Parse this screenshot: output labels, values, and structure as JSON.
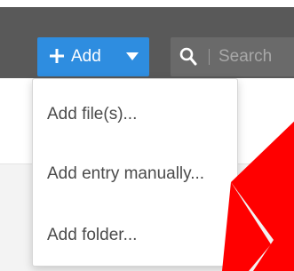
{
  "toolbar": {
    "add_label": "Add",
    "add_icon": "plus-icon",
    "caret_icon": "caret-down-icon",
    "search_icon": "search-icon",
    "search_placeholder": "Search"
  },
  "add_menu": {
    "items": [
      {
        "label": "Add file(s)..."
      },
      {
        "label": "Add entry manually..."
      },
      {
        "label": "Add folder..."
      }
    ]
  },
  "annotation": {
    "arrow_color": "#ff0000"
  },
  "colors": {
    "toolbar_bg": "#595959",
    "accent": "#2e8de0"
  }
}
